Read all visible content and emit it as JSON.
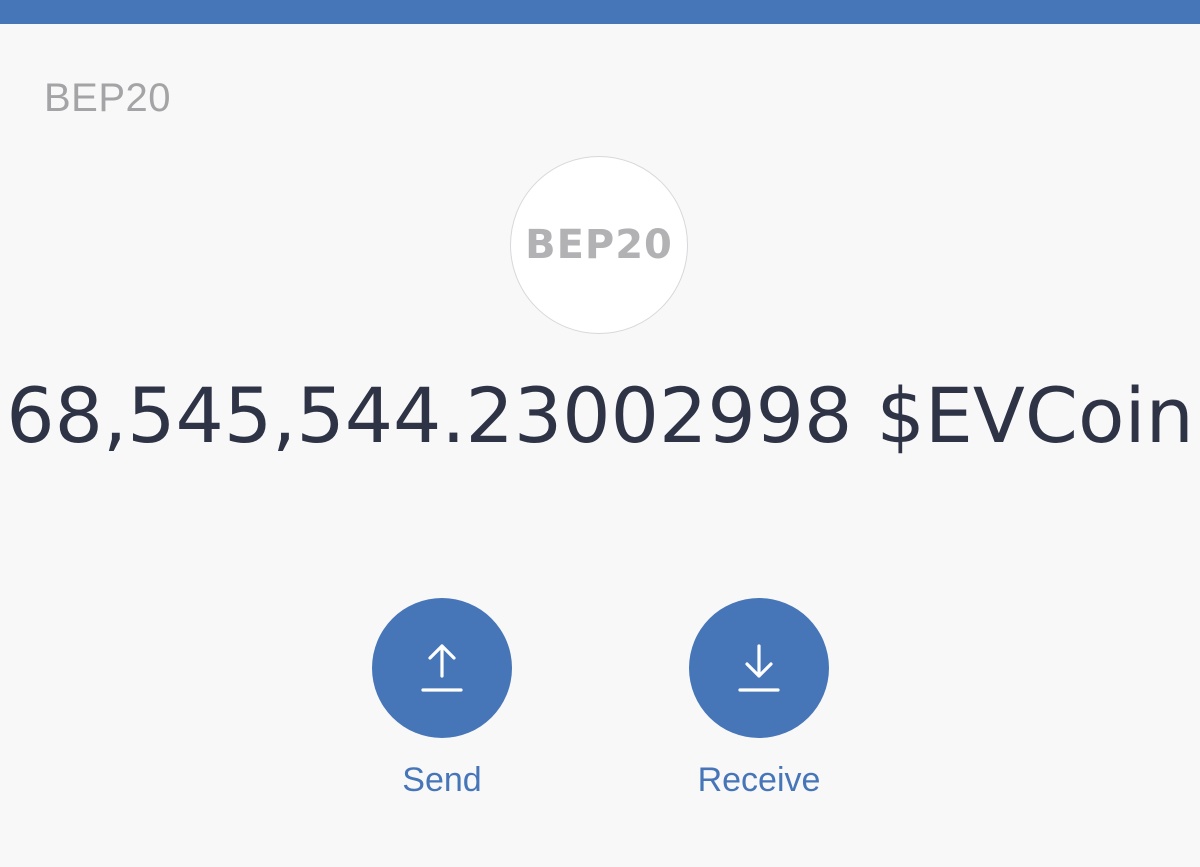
{
  "header": {
    "network_label": "BEP20",
    "bar_color": "#4675b8"
  },
  "token": {
    "logo_text": "BEP20",
    "balance": "68,545,544.23002998 $EVCoin"
  },
  "actions": {
    "send": {
      "label": "Send",
      "icon": "arrow-up-icon"
    },
    "receive": {
      "label": "Receive",
      "icon": "arrow-down-icon"
    }
  },
  "colors": {
    "accent": "#4675b8",
    "background": "#f8f8f9",
    "balance_text": "#2e3446",
    "muted_text": "#a4a4a6"
  }
}
